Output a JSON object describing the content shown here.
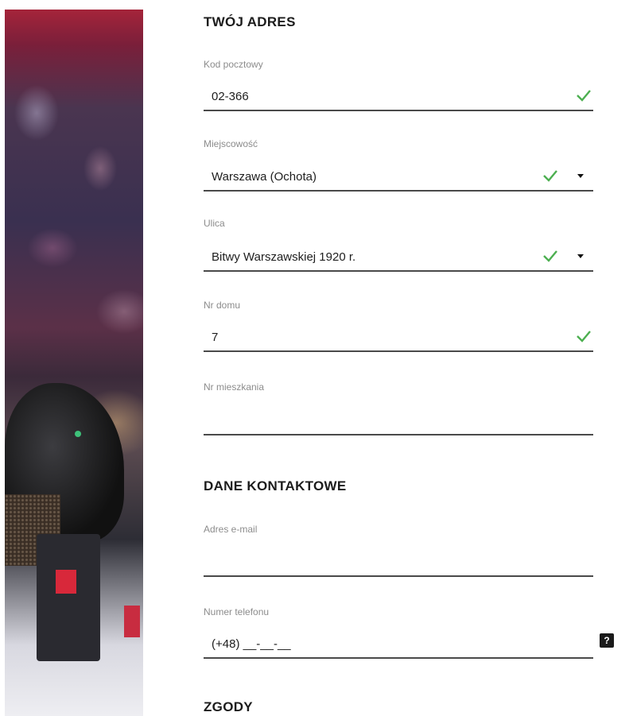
{
  "address_section": {
    "title": "TWÓJ ADRES",
    "postal_code": {
      "label": "Kod pocztowy",
      "value": "02-366",
      "valid": true
    },
    "city": {
      "label": "Miejscowość",
      "value": "Warszawa (Ochota)",
      "valid": true
    },
    "street": {
      "label": "Ulica",
      "value": "Bitwy Warszawskiej 1920 r.",
      "valid": true
    },
    "house_number": {
      "label": "Nr domu",
      "value": "7",
      "valid": true
    },
    "apartment_number": {
      "label": "Nr mieszkania",
      "value": ""
    }
  },
  "contact_section": {
    "title": "DANE KONTAKTOWE",
    "email": {
      "label": "Adres e-mail",
      "value": ""
    },
    "phone": {
      "label": "Numer telefonu",
      "value": "(+48) __-__-__",
      "help_label": "?"
    }
  },
  "consents_section": {
    "title": "ZGODY"
  },
  "colors": {
    "valid_check": "#4caf50",
    "underline": "#4a4a4a",
    "label": "#8c8c8c"
  },
  "icons": {
    "valid": "checkmark-icon",
    "dropdown": "caret-down-icon",
    "help": "question-icon"
  }
}
